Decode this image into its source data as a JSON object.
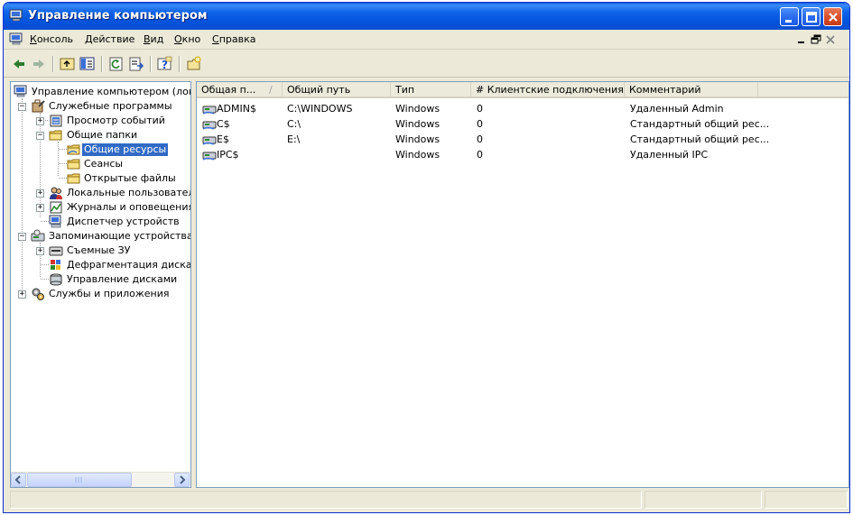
{
  "window": {
    "title": "Управление компьютером"
  },
  "menubar": {
    "items": [
      {
        "underline": "К",
        "rest": "онсоль"
      },
      {
        "underline": "Д",
        "rest": "ействие"
      },
      {
        "underline": "В",
        "rest": "ид"
      },
      {
        "underline": "О",
        "rest": "кно"
      },
      {
        "underline": "С",
        "rest": "правка"
      }
    ]
  },
  "tree": {
    "root": "Управление компьютером (локаль",
    "items": [
      {
        "label": "Служебные программы"
      },
      {
        "label": "Просмотр событий"
      },
      {
        "label": "Общие папки"
      },
      {
        "label": "Общие ресурсы"
      },
      {
        "label": "Сеансы"
      },
      {
        "label": "Открытые файлы"
      },
      {
        "label": "Локальные пользователи и"
      },
      {
        "label": "Журналы и оповещения пр"
      },
      {
        "label": "Диспетчер устройств"
      },
      {
        "label": "Запоминающие устройства"
      },
      {
        "label": "Съемные ЗУ"
      },
      {
        "label": "Дефрагментация диска"
      },
      {
        "label": "Управление дисками"
      },
      {
        "label": "Службы и приложения"
      }
    ]
  },
  "list": {
    "columns": [
      "Общая п...",
      "Общий путь",
      "Тип",
      "# Клиентские подключения",
      "Комментарий"
    ],
    "rows": [
      {
        "name": "ADMIN$",
        "path": "C:\\WINDOWS",
        "type": "Windows",
        "clients": "0",
        "comment": "Удаленный Admin"
      },
      {
        "name": "C$",
        "path": "C:\\",
        "type": "Windows",
        "clients": "0",
        "comment": "Стандартный общий рес..."
      },
      {
        "name": "E$",
        "path": "E:\\",
        "type": "Windows",
        "clients": "0",
        "comment": "Стандартный общий рес..."
      },
      {
        "name": "IPC$",
        "path": "",
        "type": "Windows",
        "clients": "0",
        "comment": "Удаленный IPC"
      }
    ]
  }
}
